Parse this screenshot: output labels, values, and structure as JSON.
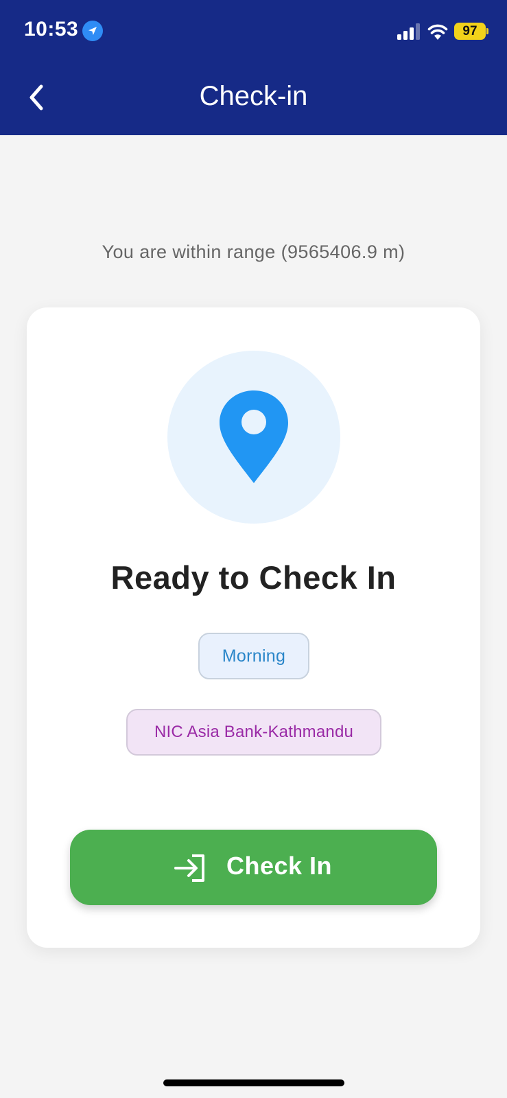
{
  "status_bar": {
    "time": "10:53",
    "location_icon": "location-arrow-icon",
    "signal_icon": "cellular-signal-icon",
    "wifi_icon": "wifi-icon",
    "battery": "97",
    "battery_color": "#f2d21a"
  },
  "header": {
    "back_icon": "chevron-left-icon",
    "title": "Check-in",
    "background_color": "#162a87"
  },
  "range_message": "You are within range (9565406.9 m)",
  "card": {
    "icon": "map-pin-icon",
    "icon_color": "#2196f3",
    "title": "Ready to Check In",
    "shift_label": "Morning",
    "branch_label": "NIC Asia Bank-Kathmandu",
    "button": {
      "label": "Check In",
      "icon": "login-arrow-icon",
      "color": "#4caf50"
    }
  }
}
